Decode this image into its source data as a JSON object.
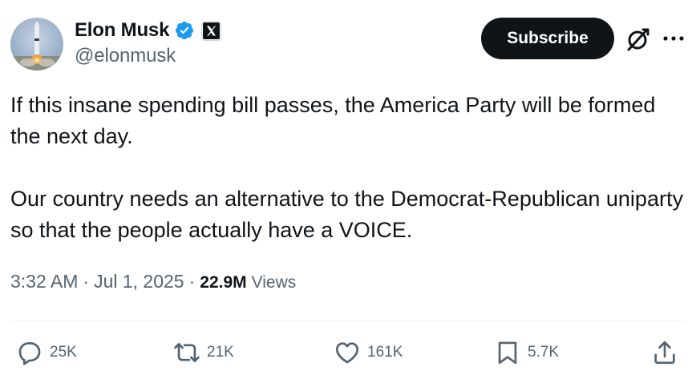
{
  "author": {
    "display_name": "Elon Musk",
    "handle": "@elonmusk",
    "verified_color": "#1d9bf0"
  },
  "header": {
    "subscribe_label": "Subscribe",
    "icons": [
      "grok-icon",
      "more-icon"
    ]
  },
  "tweet": {
    "paragraphs": [
      "If this insane spending bill passes, the America Party will be formed the next day.",
      "Our country needs an alternative to the Democrat-Republican uniparty so that the people actually have a VOICE."
    ]
  },
  "meta": {
    "time": "3:32 AM",
    "separator": "·",
    "date": "Jul 1, 2025",
    "views_count": "22.9M",
    "views_label": "Views"
  },
  "actions": {
    "replies": "25K",
    "reposts": "21K",
    "likes": "161K",
    "bookmarks": "5.7K"
  },
  "colors": {
    "text_primary": "#0f1419",
    "text_secondary": "#536471",
    "accent": "#1d9bf0",
    "button_dark": "#0f1419"
  }
}
